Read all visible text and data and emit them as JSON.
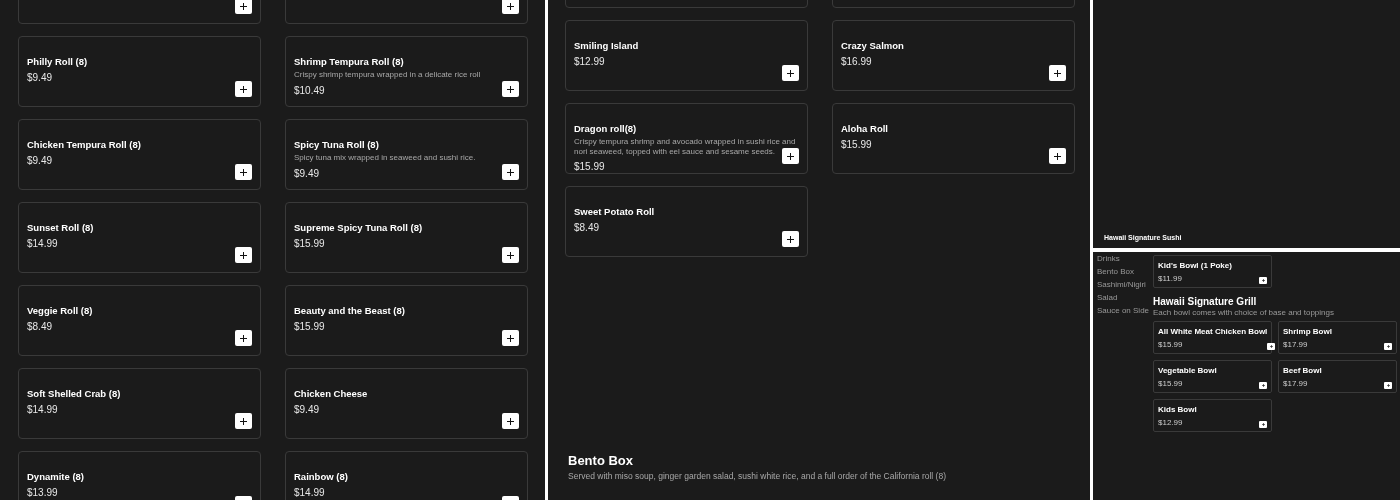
{
  "left_panel": {
    "cut_off_row": [
      {
        "kind": "stub"
      },
      {
        "kind": "stub"
      }
    ],
    "cards": [
      {
        "kind": "item",
        "name": "Philly Roll (8)",
        "price": "$9.49"
      },
      {
        "kind": "item",
        "name": "Shrimp Tempura Roll (8)",
        "description": "Crispy shrimp tempura wrapped in a delicate rice roll",
        "price": "$10.49"
      },
      {
        "kind": "item",
        "name": "Chicken Tempura Roll (8)",
        "price": "$9.49"
      },
      {
        "kind": "item",
        "name": "Spicy Tuna Roll (8)",
        "description": "Spicy tuna mix wrapped in seaweed and sushi rice.",
        "price": "$9.49"
      },
      {
        "kind": "item",
        "name": "Sunset Roll (8)",
        "price": "$14.99"
      },
      {
        "kind": "item",
        "name": "Supreme Spicy Tuna Roll (8)",
        "price": "$15.99"
      },
      {
        "kind": "item",
        "name": "Veggie Roll (8)",
        "price": "$8.49"
      },
      {
        "kind": "item",
        "name": "Beauty and the Beast (8)",
        "price": "$15.99"
      },
      {
        "kind": "item",
        "name": "Soft Shelled Crab (8)",
        "price": "$14.99"
      },
      {
        "kind": "item",
        "name": "Chicken Cheese",
        "price": "$9.49"
      },
      {
        "kind": "item",
        "name": "Dynamite (8)",
        "price": "$13.99"
      },
      {
        "kind": "item",
        "name": "Rainbow (8)",
        "price": "$14.99"
      }
    ]
  },
  "middle_panel": {
    "cut_off_row": [
      {
        "kind": "stub"
      },
      {
        "kind": "stub"
      }
    ],
    "cards": [
      {
        "kind": "item",
        "name": "Smiling Island",
        "price": "$12.99"
      },
      {
        "kind": "item",
        "name": "Crazy Salmon",
        "price": "$16.99"
      },
      {
        "kind": "item",
        "name": "Dragon roll(8)",
        "description": "Crispy tempura shrimp and avocado wrapped in sushi rice and nori seaweed, topped with eel sauce and sesame seeds.",
        "price": "$15.99"
      },
      {
        "kind": "item",
        "name": "Aloha Roll",
        "price": "$15.99"
      },
      {
        "kind": "item",
        "name": "Sweet Potato Roll",
        "price": "$8.49"
      }
    ],
    "section": {
      "title": "Bento Box",
      "description": "Served with miso soup, ginger garden salad, sushi white rice, and a full order of the California roll (8)"
    }
  },
  "right_top_panel": {
    "title": "Hawaii Signature Sushi"
  },
  "right_bottom_panel": {
    "sidebar": {
      "items": [
        "Drinks",
        "Bento Box",
        "Sashimi/Nigiri",
        "Salad",
        "Sauce on Side"
      ]
    },
    "top_cards": [
      {
        "kind": "item",
        "name": "Kid's Bowl (1 Poke)",
        "price": "$11.99"
      }
    ],
    "section": {
      "title": "Hawaii Signature Grill",
      "description": "Each bowl comes with choice of base and toppings",
      "cards": [
        {
          "kind": "item",
          "name": "All White Meat Chicken Bowl",
          "price": "$15.99"
        },
        {
          "kind": "item",
          "name": "Shrimp Bowl",
          "price": "$17.99"
        },
        {
          "kind": "item",
          "name": "Vegetable Bowl",
          "price": "$15.99"
        },
        {
          "kind": "item",
          "name": "Beef Bowl",
          "price": "$17.99"
        },
        {
          "kind": "item",
          "name": "Kids Bowl",
          "price": "$12.99"
        }
      ]
    }
  }
}
